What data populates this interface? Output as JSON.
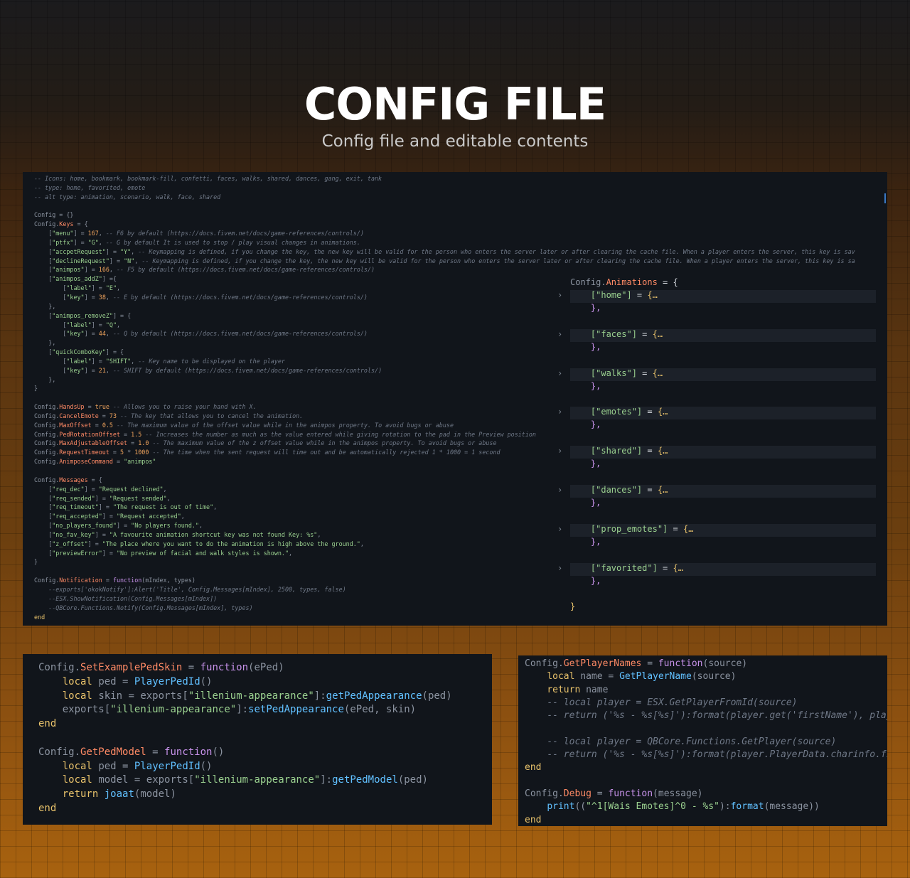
{
  "header": {
    "title": "CONFIG FILE",
    "subtitle": "Config file and editable contents"
  },
  "main_code": [
    "-- Icons: home, bookmark, bookmark-fill, confetti, faces, walks, shared, dances, gang, exit, tank",
    "-- type: home, favorited, emote",
    "-- alt type: animation, scenario, walk, face, shared",
    "",
    "Config = {}",
    "Config.Keys = {",
    "    [\"menu\"] = 167, -- F6 by default (https://docs.fivem.net/docs/game-references/controls/)",
    "    [\"ptfx\"] = \"G\", -- G by default It is used to stop / play visual changes in animations.",
    "    [\"accpetRequest\"] = \"Y\", -- Keymapping is defined, if you change the key, the new key will be valid for the person who enters the server later or after clearing the cache file. When a player enters the server, this key is sav",
    "    [\"declineRequest\"] = \"N\", -- Keymapping is defined, if you change the key, the new key will be valid for the person who enters the server later or after clearing the cache file. When a player enters the server, this key is sa",
    "    [\"animpos\"] = 166, -- F5 by default (https://docs.fivem.net/docs/game-references/controls/)",
    "    [\"animpos_addZ\"] ={",
    "        [\"label\"] = \"E\",",
    "        [\"key\"] = 38, -- E by default (https://docs.fivem.net/docs/game-references/controls/)",
    "    },",
    "    [\"animpos_removeZ\"] = {",
    "        [\"label\"] = \"Q\",",
    "        [\"key\"] = 44, -- Q by default (https://docs.fivem.net/docs/game-references/controls/)",
    "    },",
    "    [\"quickComboKey\"] = {",
    "        [\"label\"] = \"SHIFT\", -- Key name to be displayed on the player",
    "        [\"key\"] = 21, -- SHIFT by default (https://docs.fivem.net/docs/game-references/controls/)",
    "    },",
    "}",
    "",
    "Config.HandsUp = true -- Allows you to raise your hand with X.",
    "Config.CancelEmote = 73 -- The key that allows you to cancel the animation.",
    "Config.MaxOffset = 0.5 -- The maximum value of the offset value while in the animpos property. To avoid bugs or abuse",
    "Config.PedRotationOffset = 1.5 -- Increases the number as much as the value entered while giving rotation to the pad in the Preview position",
    "Config.MaxAdjustableOffset = 1.0 -- The maximum value of the z offset value while in the animpos property. To avoid bugs or abuse",
    "Config.RequestTimeout = 5 * 1000 -- The time when the sent request will time out and be automatically rejected 1 * 1000 = 1 second",
    "Config.AnimposeCommand = \"animpos\"",
    "",
    "Config.Messages = {",
    "    [\"req_dec\"] = \"Request declined\",",
    "    [\"req_sended\"] = \"Request sended\",",
    "    [\"req_timeout\"] = \"The request is out of time\",",
    "    [\"req_accepted\"] = \"Request accepted\",",
    "    [\"no_players_found\"] = \"No players found.\",",
    "    [\"no_fav_key\"] = \"A favourite animation shortcut key was not found Key: %s\",",
    "    [\"z_offset\"] = \"The place where you want to do the animation is high above the ground.\",",
    "    [\"previewError\"] = \"No preview of facial and walk styles is shown.\",",
    "}",
    "",
    "Config.Notification = function(mIndex, types)",
    "    --exports['okokNotify']:Alert('Title', Config.Messages[mIndex], 2500, types, false)",
    "    --ESX.ShowNotification(Config.Messages[mIndex])",
    "    --QBCore.Functions.Notify(Config.Messages[mIndex], types)",
    "end"
  ],
  "animations": {
    "header": "Config.Animations = {",
    "entries": [
      "[\"home\"] = {…",
      "[\"faces\"] = {…",
      "[\"walks\"] = {…",
      "[\"emotes\"] = {…",
      "[\"shared\"] = {…",
      "[\"dances\"] = {…",
      "[\"prop_emotes\"] = {…",
      "[\"favorited\"] = {…"
    ],
    "entry_close": "},",
    "close": "}"
  },
  "ped_code": [
    "Config.SetExamplePedSkin = function(ePed)",
    "    local ped = PlayerPedId()",
    "    local skin = exports[\"illenium-appearance\"]:getPedAppearance(ped)",
    "    exports[\"illenium-appearance\"]:setPedAppearance(ePed, skin)",
    "end",
    "",
    "Config.GetPedModel = function()",
    "    local ped = PlayerPedId()",
    "    local model = exports[\"illenium-appearance\"]:getPedModel(ped)",
    "    return joaat(model)",
    "end"
  ],
  "player_code": [
    "Config.GetPlayerNames = function(source)",
    "    local name = GetPlayerName(source)",
    "    return name",
    "    -- local player = ESX.GetPlayerFromId(source)",
    "    -- return ('%s - %s[%s]'):format(player.get('firstName'), player.get",
    "",
    "    -- local player = QBCore.Functions.GetPlayer(source)",
    "    -- return ('%s - %s[%s]'):format(player.PlayerData.charinfo.firstname",
    "end",
    "",
    "Config.Debug = function(message)",
    "    print((\"^1[Wais Emotes]^0 - %s\"):format(message))",
    "end"
  ],
  "colors": {
    "panel_bg": "#11151b",
    "comment": "#6f7887",
    "keyword": "#c792ea",
    "function": "#61c0ff",
    "string": "#9ad08f",
    "number": "#f0a45d",
    "property": "#ff8a65",
    "accent": "#a8620f"
  }
}
